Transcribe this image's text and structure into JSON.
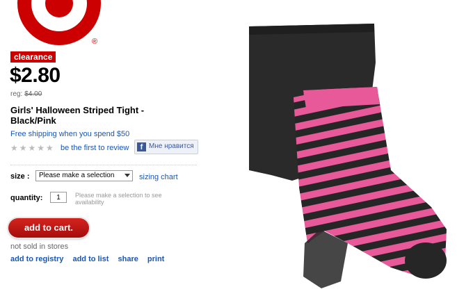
{
  "brand": {
    "logo_icon": "target-bullseye-logo",
    "registered_mark": "®",
    "color": "#cc0000"
  },
  "product": {
    "badge": "clearance",
    "price": "$2.80",
    "reg_label": "reg:",
    "reg_price": "$4.00",
    "title": "Girls' Halloween Striped Tight - Black/Pink",
    "shipping": "Free shipping when you spend $50",
    "rating_stars": "★★★★★",
    "first_review": "be the first to review",
    "facebook_like": "Мне нравится",
    "image_icon": "striped-tights-image"
  },
  "options": {
    "size_label": "size :",
    "size_value": "Please make a selection",
    "sizing_chart": "sizing chart",
    "quantity_label": "quantity:",
    "quantity_value": "1",
    "quantity_note": "Please make a selection to see availability"
  },
  "actions": {
    "add_to_cart": "add to cart.",
    "not_sold": "not sold in stores",
    "add_to_registry": "add to registry",
    "add_to_list": "add to list",
    "share": "share",
    "print": "print"
  }
}
